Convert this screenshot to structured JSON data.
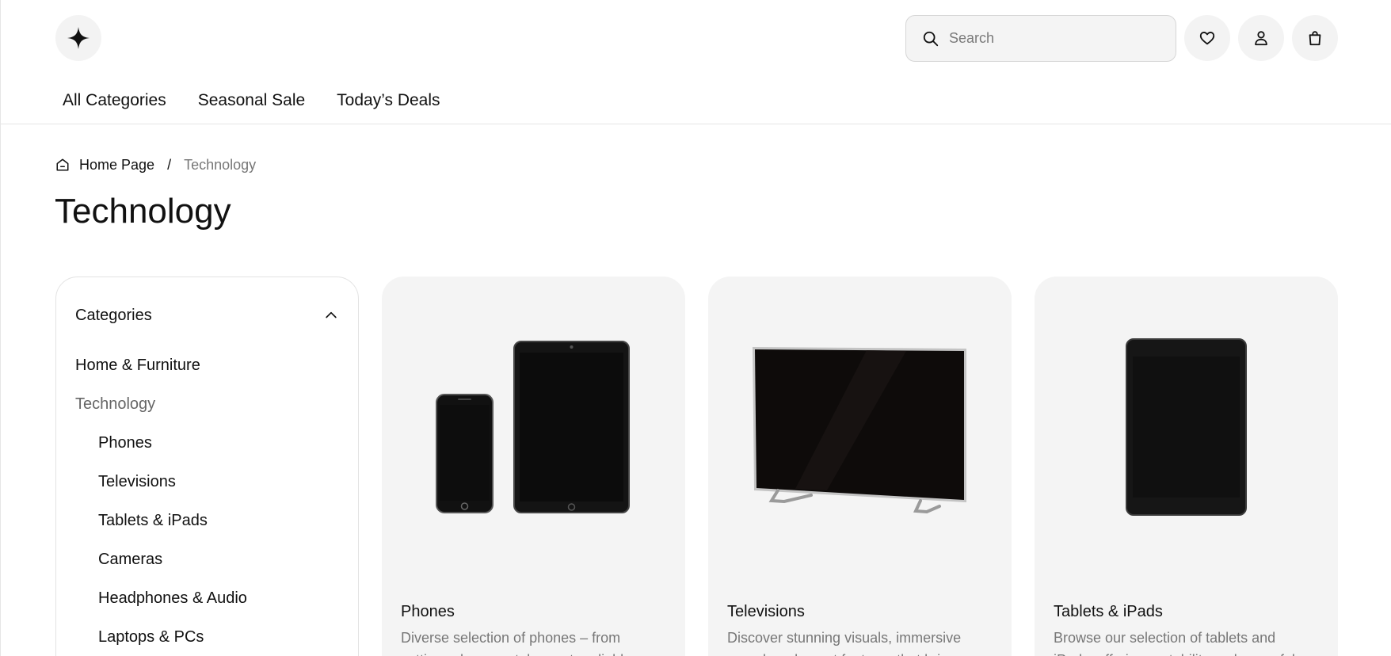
{
  "header": {
    "logo_icon": "sparkle-icon",
    "search": {
      "placeholder": "Search",
      "value": ""
    },
    "actions": [
      "heart-icon",
      "user-icon",
      "bag-icon"
    ],
    "nav": [
      "All Categories",
      "Seasonal Sale",
      "Today’s Deals"
    ]
  },
  "breadcrumb": {
    "home": "Home Page",
    "separator": "/",
    "current": "Technology"
  },
  "page_title": "Technology",
  "sidebar": {
    "title": "Categories",
    "items": [
      {
        "label": "Home & Furniture",
        "level": 0,
        "active": false
      },
      {
        "label": "Technology",
        "level": 0,
        "active": true
      },
      {
        "label": "Phones",
        "level": 1,
        "active": false
      },
      {
        "label": "Televisions",
        "level": 1,
        "active": false
      },
      {
        "label": "Tablets & iPads",
        "level": 1,
        "active": false
      },
      {
        "label": "Cameras",
        "level": 1,
        "active": false
      },
      {
        "label": "Headphones & Audio",
        "level": 1,
        "active": false
      },
      {
        "label": "Laptops & PCs",
        "level": 1,
        "active": false
      }
    ]
  },
  "cards": [
    {
      "title": "Phones",
      "description": "Diverse selection of phones – from cutting-edge smartphones to reliable"
    },
    {
      "title": "Televisions",
      "description": "Discover stunning visuals, immersive sound, and smart features that bring"
    },
    {
      "title": "Tablets & iPads",
      "description": "Browse our selection of tablets and iPads, offering portability and powerful"
    }
  ],
  "colors": {
    "accent": "#111111",
    "muted_text": "#777777",
    "card_bg": "#f4f4f4",
    "border": "#e6e6e6"
  }
}
